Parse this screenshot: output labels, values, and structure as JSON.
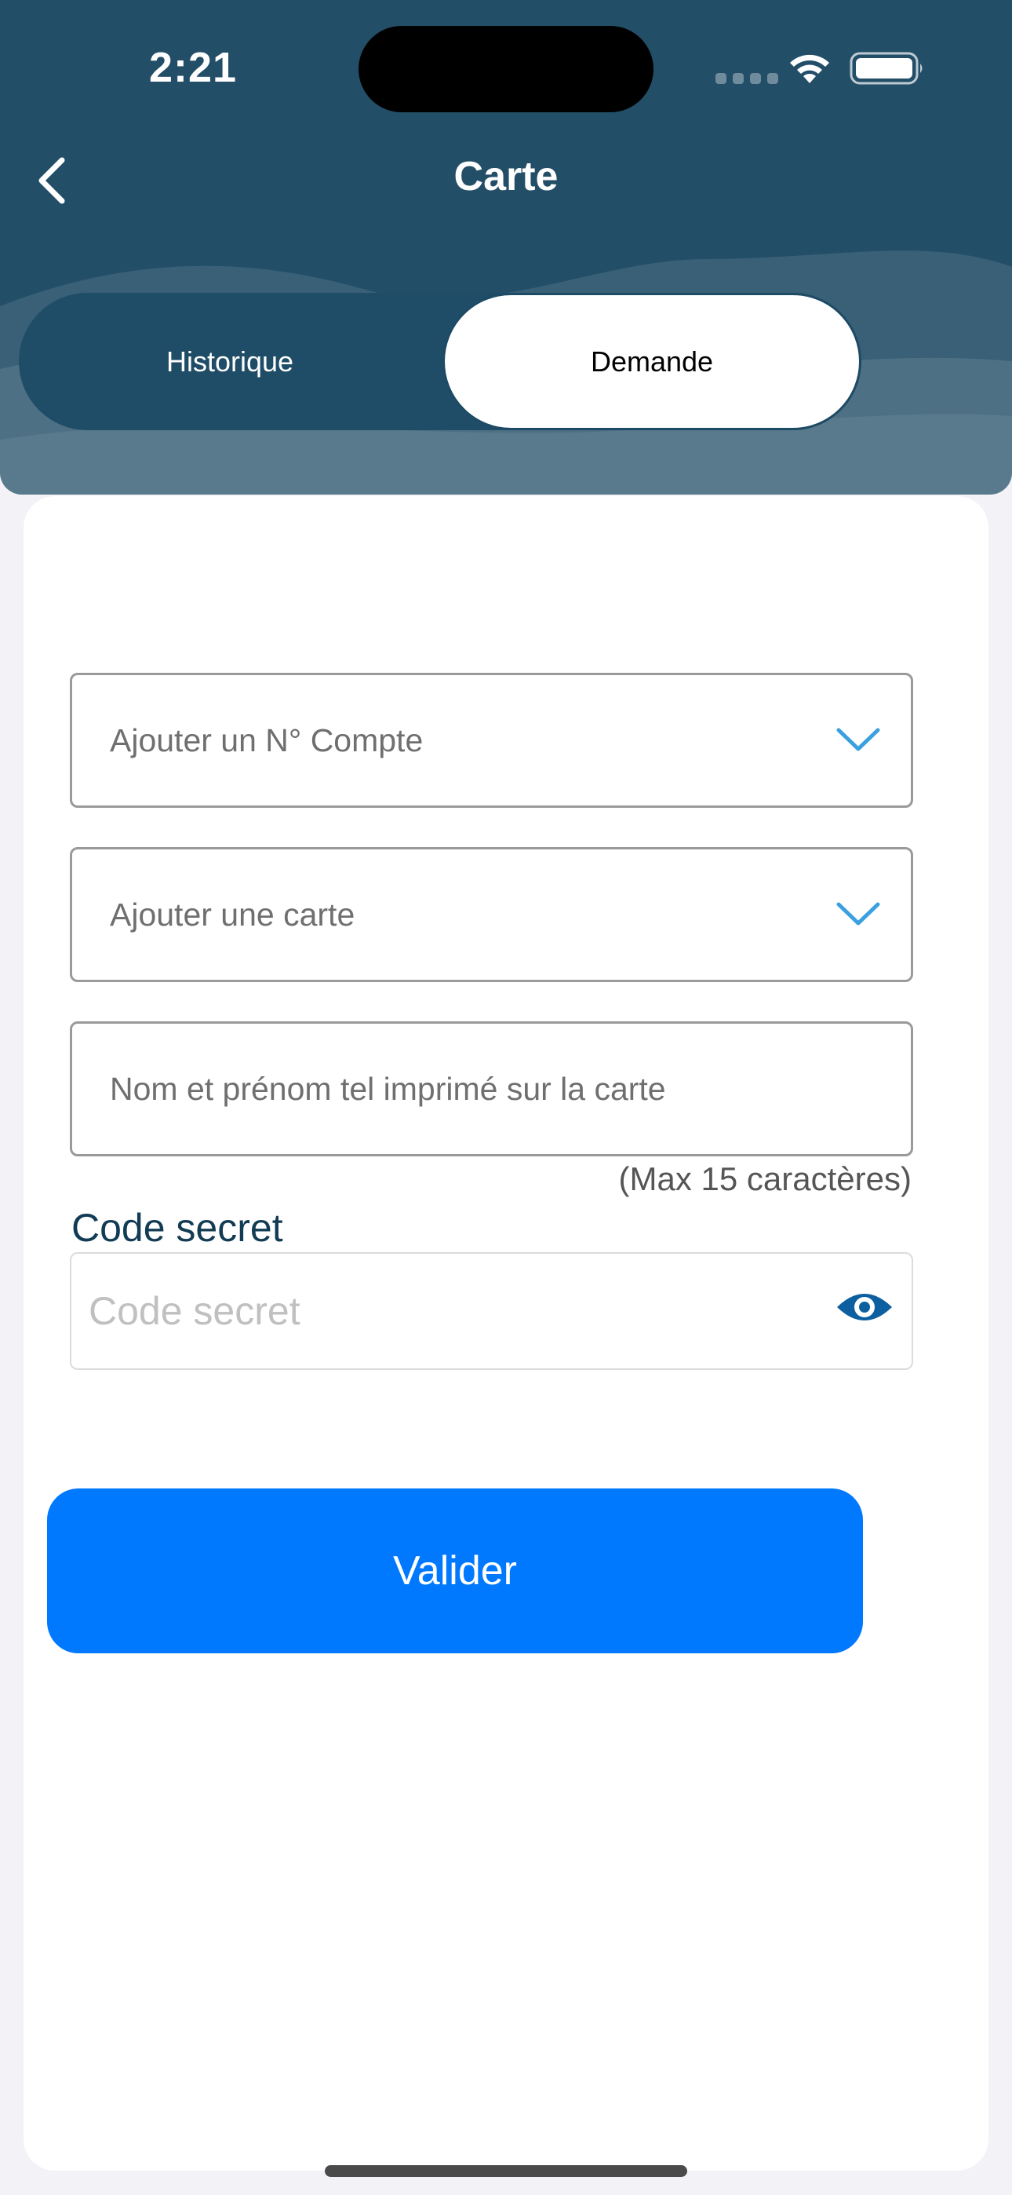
{
  "status_bar": {
    "time": "2:21"
  },
  "nav": {
    "title": "Carte"
  },
  "segmented": {
    "historique": "Historique",
    "demande": "Demande",
    "selected": "Demande"
  },
  "form": {
    "account_placeholder": "Ajouter un N° Compte",
    "card_placeholder": "Ajouter une carte",
    "name_placeholder": "Nom et prénom tel imprimé sur la carte",
    "name_hint": "(Max 15 caractères)",
    "code_label": "Code secret",
    "code_placeholder": "Code secret",
    "submit_label": "Valider"
  },
  "icons": {
    "back": "chevron-left-icon",
    "dropdown": "chevron-down-icon",
    "visibility": "eye-icon",
    "wifi": "wifi-icon",
    "battery": "battery-icon"
  },
  "colors": {
    "header": "#234e68",
    "accent": "#0079ff",
    "chevron": "#3aa0e0",
    "eye": "#0d5fa0",
    "label": "#123c54"
  }
}
